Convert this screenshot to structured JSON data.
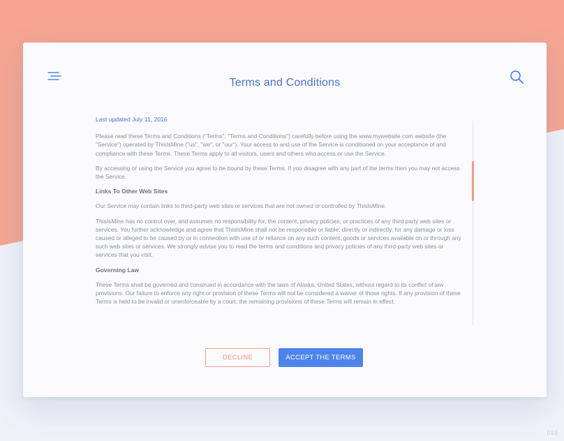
{
  "colors": {
    "accent_background": "#f5a592",
    "page_background": "#eef1f8",
    "title_blue": "#4a72c9",
    "button_blue": "#4d84ea",
    "decline_orange": "#ef8d78"
  },
  "header": {
    "menu_icon": "hamburger-menu-icon",
    "search_icon": "search-icon",
    "title": "Terms and Conditions"
  },
  "terms": {
    "last_updated": "Last updated July 11, 2016",
    "paragraphs": [
      "Please read these Terms and Conditions (\"Terms\", \"Terms and Conditions\") carefully before using the www.mywebsite.com website (the \"Service\") operated by ThisIsMine (\"us\", \"we\", or \"our\"). Your access to and use of the Service is conditioned on your acceptance of and compliance with these Terms. These Terms apply to all visitors, users and others who access or use the Service.",
      "By accessing or using the Service you agree to be bound by these Terms. If you disagree with any part of the terms then you may not access the Service."
    ],
    "section_links_title": "Links To Other Web Sites",
    "section_links_paragraphs": [
      "Our Service may contain links to third-party web sites or services that are not owned or controlled by ThisIsMine.",
      "ThisIsMine has no control over, and assumes no responsibility for, the content, privacy policies, or practices of any third party web sites or services. You further acknowledge and agree that ThisIsMine shall not be responsible or liable, directly or indirectly, for any damage or loss caused or alleged to be caused by or in connection with use of or reliance on any such content, goods or services available on or through any such web sites or services. We strongly advise you to read the terms and conditions and privacy policies of any third-party web sites or services that you visit."
    ],
    "section_law_title": "Governing Law",
    "section_law_paragraph": "These Terms shall be governed and construed in accordance with the laws of Alaska, United States, without regard to its conflict of law provisions. Our failure to enforce any right or provision of these Terms will not be considered a waiver of those rights. If any provision of these Terms is held to be invalid or unenforceable by a court, the remaining provisions of these Terms will remain in effect."
  },
  "actions": {
    "decline_label": "DECLINE",
    "accept_label": "ACCEPT THE TERMS"
  },
  "corner_mark": "▯▯▯"
}
